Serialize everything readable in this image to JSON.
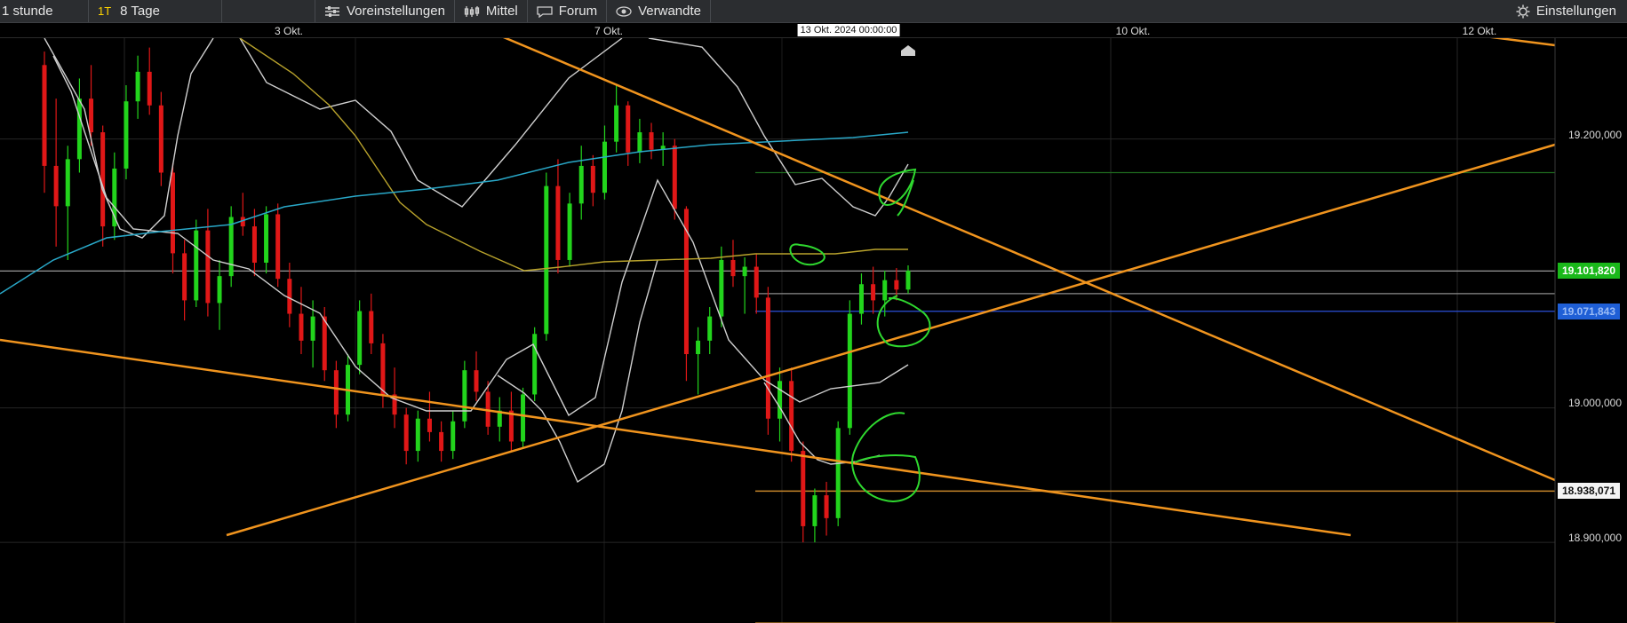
{
  "toolbar": {
    "timeframe": "1 stunde",
    "range_badge": "1T",
    "range_label": "8 Tage",
    "settings_label": "Voreinstellungen",
    "indicator_label": "Mittel",
    "forum_label": "Forum",
    "related_label": "Verwandte",
    "config_label": "Einstellungen"
  },
  "axis": {
    "dates": [
      {
        "label": "3 Okt.",
        "time": 3.0
      },
      {
        "label": "7 Okt.",
        "time": 7.0
      },
      {
        "label": "10 Okt.",
        "time": 10.0
      },
      {
        "label": "12 Okt.",
        "time": 12.0
      }
    ],
    "cursor_date": "13 Okt. 2024 00:00:00",
    "prices": [
      {
        "label": "19.200,000",
        "value": 19200
      },
      {
        "label": "19.000,000",
        "value": 19000
      },
      {
        "label": "18.900,000",
        "value": 18900
      }
    ]
  },
  "tags": {
    "last_price": {
      "label": "19.101,820",
      "value": 19101.82,
      "color": "#22c41e"
    },
    "blue_level": {
      "label": "19.071,843",
      "value": 19071.843,
      "color": "#1f5fd6"
    },
    "orange_level": {
      "label": "18.938,071",
      "value": 18938.071,
      "color": "#ffffff"
    }
  },
  "chart_data": {
    "type": "candlestick",
    "xlabel": "",
    "ylabel": "",
    "y_axis_side": "right",
    "grid": true,
    "ylim": [
      18840,
      19275
    ],
    "candles_note": "hourly candles 1–8 Okt. 2024",
    "ohlc": [
      [
        19255,
        19265,
        19160,
        19180
      ],
      [
        19180,
        19230,
        19120,
        19150
      ],
      [
        19150,
        19195,
        19110,
        19185
      ],
      [
        19185,
        19245,
        19175,
        19230
      ],
      [
        19230,
        19255,
        19195,
        19205
      ],
      [
        19205,
        19210,
        19120,
        19135
      ],
      [
        19135,
        19190,
        19125,
        19178
      ],
      [
        19178,
        19240,
        19170,
        19228
      ],
      [
        19228,
        19262,
        19215,
        19250
      ],
      [
        19250,
        19268,
        19218,
        19225
      ],
      [
        19225,
        19235,
        19165,
        19175
      ],
      [
        19175,
        19182,
        19100,
        19115
      ],
      [
        19115,
        19125,
        19065,
        19080
      ],
      [
        19080,
        19140,
        19075,
        19132
      ],
      [
        19132,
        19148,
        19068,
        19078
      ],
      [
        19078,
        19110,
        19058,
        19098
      ],
      [
        19098,
        19150,
        19090,
        19142
      ],
      [
        19142,
        19160,
        19128,
        19135
      ],
      [
        19135,
        19148,
        19098,
        19108
      ],
      [
        19108,
        19150,
        19100,
        19144
      ],
      [
        19144,
        19152,
        19090,
        19096
      ],
      [
        19096,
        19108,
        19060,
        19070
      ],
      [
        19070,
        19090,
        19040,
        19050
      ],
      [
        19050,
        19080,
        19030,
        19068
      ],
      [
        19068,
        19075,
        19020,
        19028
      ],
      [
        19028,
        19035,
        18985,
        18995
      ],
      [
        18995,
        19040,
        18990,
        19032
      ],
      [
        19032,
        19080,
        19025,
        19072
      ],
      [
        19072,
        19085,
        19040,
        19048
      ],
      [
        19048,
        19055,
        19000,
        19010
      ],
      [
        19010,
        19030,
        18985,
        18995
      ],
      [
        18995,
        19000,
        18958,
        18968
      ],
      [
        18968,
        18998,
        18960,
        18992
      ],
      [
        18992,
        19012,
        18975,
        18982
      ],
      [
        18982,
        18990,
        18960,
        18968
      ],
      [
        18968,
        18998,
        18962,
        18990
      ],
      [
        18990,
        19035,
        18985,
        19028
      ],
      [
        19028,
        19042,
        19005,
        19012
      ],
      [
        19012,
        19020,
        18980,
        18986
      ],
      [
        18986,
        19008,
        18975,
        18998
      ],
      [
        18998,
        19012,
        18968,
        18975
      ],
      [
        18975,
        19015,
        18970,
        19010
      ],
      [
        19010,
        19060,
        19005,
        19055
      ],
      [
        19055,
        19175,
        19050,
        19165
      ],
      [
        19165,
        19185,
        19100,
        19110
      ],
      [
        19110,
        19160,
        19105,
        19152
      ],
      [
        19152,
        19195,
        19140,
        19180
      ],
      [
        19180,
        19188,
        19150,
        19160
      ],
      [
        19160,
        19210,
        19155,
        19198
      ],
      [
        19198,
        19240,
        19190,
        19225
      ],
      [
        19225,
        19228,
        19180,
        19190
      ],
      [
        19190,
        19215,
        19182,
        19205
      ],
      [
        19205,
        19212,
        19185,
        19192
      ],
      [
        19192,
        19205,
        19180,
        19195
      ],
      [
        19195,
        19200,
        19140,
        19148
      ],
      [
        19148,
        19150,
        19020,
        19040
      ],
      [
        19040,
        19060,
        19010,
        19050
      ],
      [
        19050,
        19075,
        19040,
        19068
      ],
      [
        19068,
        19120,
        19060,
        19110
      ],
      [
        19110,
        19125,
        19090,
        19098
      ],
      [
        19098,
        19112,
        19070,
        19105
      ],
      [
        19105,
        19115,
        19070,
        19082
      ],
      [
        19082,
        19090,
        18980,
        18992
      ],
      [
        18992,
        19030,
        18975,
        19020
      ],
      [
        19020,
        19030,
        18960,
        18968
      ],
      [
        18968,
        18975,
        18900,
        18912
      ],
      [
        18912,
        18940,
        18900,
        18935
      ],
      [
        18935,
        18945,
        18905,
        18918
      ],
      [
        18918,
        18990,
        18912,
        18985
      ],
      [
        18985,
        19080,
        18980,
        19070
      ],
      [
        19070,
        19100,
        19062,
        19092
      ],
      [
        19092,
        19105,
        19070,
        19080
      ],
      [
        19080,
        19102,
        19068,
        19095
      ],
      [
        19095,
        19104,
        19080,
        19088
      ],
      [
        19088,
        19106,
        19085,
        19102
      ]
    ],
    "series": [
      {
        "name": "",
        "values": [
          19160,
          19168,
          19175,
          19182,
          19190
        ],
        "x_pct": [
          0.486,
          0.52,
          0.56,
          0.6,
          0.64
        ]
      }
    ],
    "horizontal_levels": [
      {
        "value": 19175,
        "color": "#1e6b1e"
      },
      {
        "value": 19101.82,
        "color": "#9a9a9a"
      },
      {
        "value": 19085,
        "color": "#8c8c8c"
      },
      {
        "value": 19071.843,
        "color": "#2b4fd9"
      },
      {
        "value": 18938.071,
        "color": "#c7862a"
      },
      {
        "value": 18840,
        "color": "#c7862a"
      }
    ]
  }
}
